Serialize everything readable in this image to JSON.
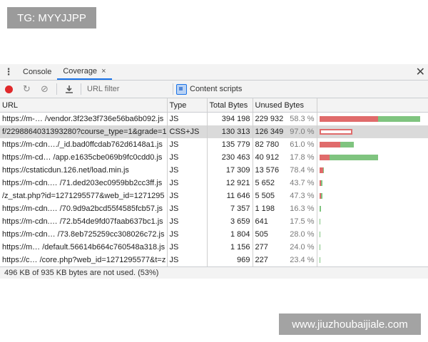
{
  "watermark_top": "TG: MYYJJPP",
  "watermark_bottom": "www.jiuzhoubaijiale.com",
  "tabs": [
    {
      "label": "Console"
    },
    {
      "label": "Coverage",
      "close": "×"
    }
  ],
  "panel_close": "✕",
  "toolbar": {
    "url_filter_placeholder": "URL filter",
    "content_scripts_label": "Content scripts"
  },
  "columns": {
    "url": "URL",
    "type": "Type",
    "total": "Total Bytes",
    "unused": "Unused Bytes"
  },
  "rows": [
    {
      "url": "https://m-… /vendor.3f23e3f736e56ba6b092.js",
      "type": "JS",
      "total": "394 198",
      "unused": "229 932",
      "pct": "58.3 %",
      "unused_frac": 0.583,
      "used_frac": 0.417,
      "bar_frac": 1.0,
      "selected": false
    },
    {
      "url": "f/2298864031393280?course_type=1&grade=1",
      "type": "CSS+JS",
      "total": "130 313",
      "unused": "126 349",
      "pct": "97.0 %",
      "unused_frac": 0.97,
      "used_frac": 0.03,
      "bar_frac": 0.33,
      "selected": true
    },
    {
      "url": "https://m-cdn…./_id.bad0ffcdab762d6148a1.js",
      "type": "JS",
      "total": "135 779",
      "unused": "82 780",
      "pct": "61.0 %",
      "unused_frac": 0.61,
      "used_frac": 0.39,
      "bar_frac": 0.34,
      "selected": false
    },
    {
      "url": "https://m-cd… /app.e1635cbe069b9fc0cdd0.js",
      "type": "JS",
      "total": "230 463",
      "unused": "40 912",
      "pct": "17.8 %",
      "unused_frac": 0.178,
      "used_frac": 0.822,
      "bar_frac": 0.58,
      "selected": false
    },
    {
      "url": "https://cstaticdun.126.net/load.min.js",
      "type": "JS",
      "total": "17 309",
      "unused": "13 576",
      "pct": "78.4 %",
      "unused_frac": 0.784,
      "used_frac": 0.216,
      "bar_frac": 0.045,
      "selected": false
    },
    {
      "url": "https://m-cdn.… /71.ded203ec0959bb2cc3ff.js",
      "type": "JS",
      "total": "12 921",
      "unused": "5 652",
      "pct": "43.7 %",
      "unused_frac": 0.437,
      "used_frac": 0.563,
      "bar_frac": 0.033,
      "selected": false
    },
    {
      "url": "/z_stat.php?id=1271295577&web_id=1271295",
      "type": "JS",
      "total": "11 646",
      "unused": "5 505",
      "pct": "47.3 %",
      "unused_frac": 0.473,
      "used_frac": 0.527,
      "bar_frac": 0.03,
      "selected": false
    },
    {
      "url": "https://m-cdn.… /70.9d9a2bcd55f4585fcb57.js",
      "type": "JS",
      "total": "7 357",
      "unused": "1 198",
      "pct": "16.3 %",
      "unused_frac": 0.163,
      "used_frac": 0.837,
      "bar_frac": 0.019,
      "selected": false
    },
    {
      "url": "https://m-cdn.… /72.b54de9fd07faab637bc1.js",
      "type": "JS",
      "total": "3 659",
      "unused": "641",
      "pct": "17.5 %",
      "unused_frac": 0.175,
      "used_frac": 0.825,
      "bar_frac": 0.009,
      "selected": false
    },
    {
      "url": "https://m-cdn… /73.8eb725259cc308026c72.js",
      "type": "JS",
      "total": "1 804",
      "unused": "505",
      "pct": "28.0 %",
      "unused_frac": 0.28,
      "used_frac": 0.72,
      "bar_frac": 0.005,
      "selected": false
    },
    {
      "url": "https://m… /default.56614b664c760548a318.js",
      "type": "JS",
      "total": "1 156",
      "unused": "277",
      "pct": "24.0 %",
      "unused_frac": 0.24,
      "used_frac": 0.76,
      "bar_frac": 0.003,
      "selected": false
    },
    {
      "url": "https://c… /core.php?web_id=1271295577&t=z",
      "type": "JS",
      "total": "969",
      "unused": "227",
      "pct": "23.4 %",
      "unused_frac": 0.234,
      "used_frac": 0.766,
      "bar_frac": 0.0025,
      "selected": false
    }
  ],
  "status": "496 KB of 935 KB bytes are not used. (53%)",
  "colors": {
    "unused": "#e06b6b",
    "used": "#7fc47f",
    "accent": "#1a73e8",
    "record": "#e0292b"
  }
}
